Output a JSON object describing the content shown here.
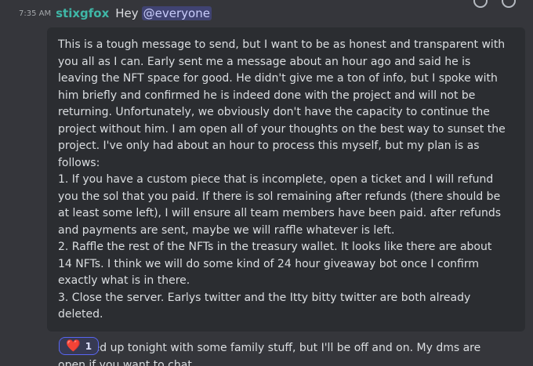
{
  "message": {
    "timestamp": "7:35 AM",
    "author": "stixgfox",
    "header_text": "Hey",
    "mention": "@everyone",
    "body": "This is a tough message to send, but I want to be as honest and transparent with you all as I can. Early sent me a message about an hour ago and said he is leaving the NFT space for good. He didn't give me a ton of info, but I spoke with him briefly and confirmed he is indeed done with the project and will not be returning. Unfortunately, we obviously don't have the capacity to continue the project without him. I am open all of your thoughts on the best way to sunset the project. I've only had about an hour to process this myself, but my plan is as follows:\n1. If you have a custom piece that is incomplete, open a ticket and I will refund you the sol that you paid. If there is sol remaining after refunds (there should be at least some left), I will ensure all team members have been paid. after refunds and payments are sent, maybe we will raffle whatever is left.\n2. Raffle the rest of the NFTs in the treasury wallet. It looks like there are about 14 NFTs. I think we will do some kind of 24 hour giveaway bot once I confirm exactly what is in there.\n3. Close the server. Earlys twitter and the Itty bitty twitter are both already deleted.\n\nI am tied up tonight with some family stuff, but I'll be off and on. My dms are open if you want to chat."
  },
  "reaction": {
    "emoji": "❤️",
    "count": "1"
  }
}
